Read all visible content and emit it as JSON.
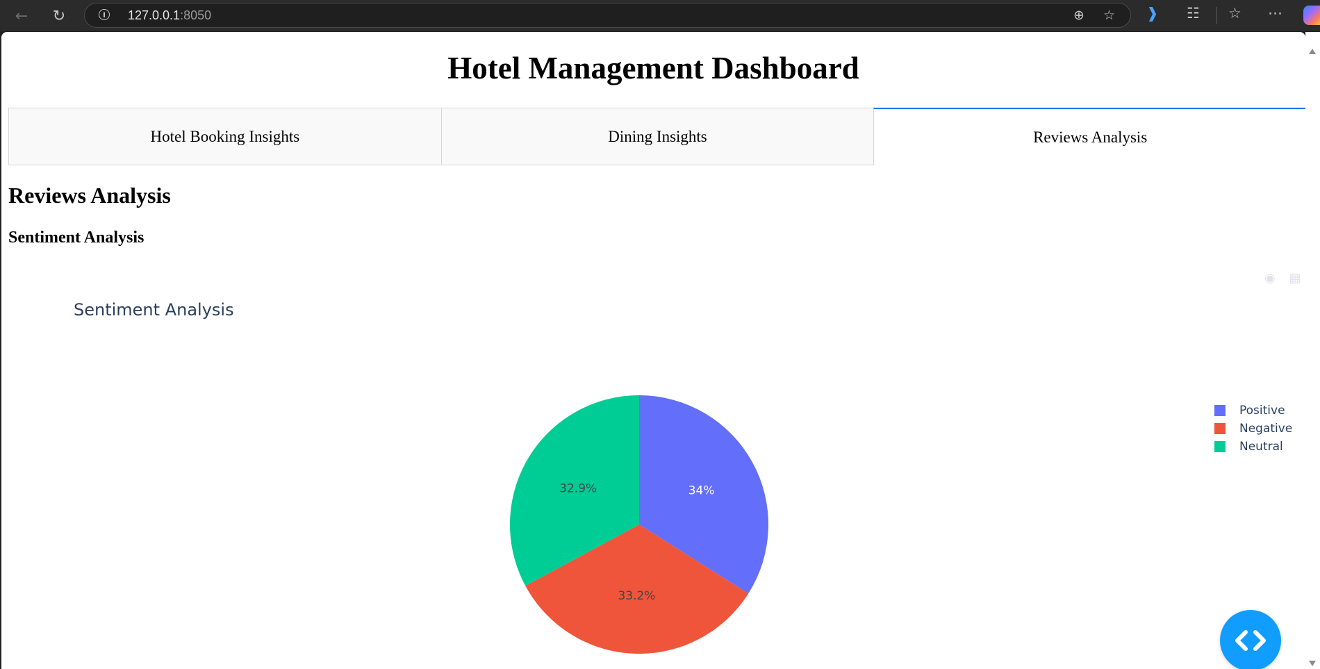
{
  "browser": {
    "url_host": "127.0.0.1",
    "url_port": ":8050"
  },
  "page": {
    "title": "Hotel Management Dashboard",
    "tabs": [
      {
        "label": "Hotel Booking Insights",
        "active": false
      },
      {
        "label": "Dining Insights",
        "active": false
      },
      {
        "label": "Reviews Analysis",
        "active": true
      }
    ],
    "section_heading": "Reviews Analysis",
    "subsection_heading": "Sentiment Analysis"
  },
  "chart_data": {
    "type": "pie",
    "title": "Sentiment Analysis",
    "categories": [
      "Positive",
      "Negative",
      "Neutral"
    ],
    "values": [
      34,
      33.2,
      32.9
    ],
    "labels": [
      "34%",
      "33.2%",
      "32.9%"
    ],
    "colors": [
      "#636efa",
      "#ef553b",
      "#00cc96"
    ],
    "legend_position": "right"
  },
  "icons": {
    "back": "arrow-left-icon",
    "reload": "reload-icon",
    "info": "info-icon",
    "zoom": "zoom-icon",
    "favorite": "star-icon",
    "read_aloud": "read-aloud-icon",
    "extensions": "puzzle-icon",
    "favorites": "favorites-icon",
    "more": "more-icon",
    "debug": "code-icon"
  }
}
